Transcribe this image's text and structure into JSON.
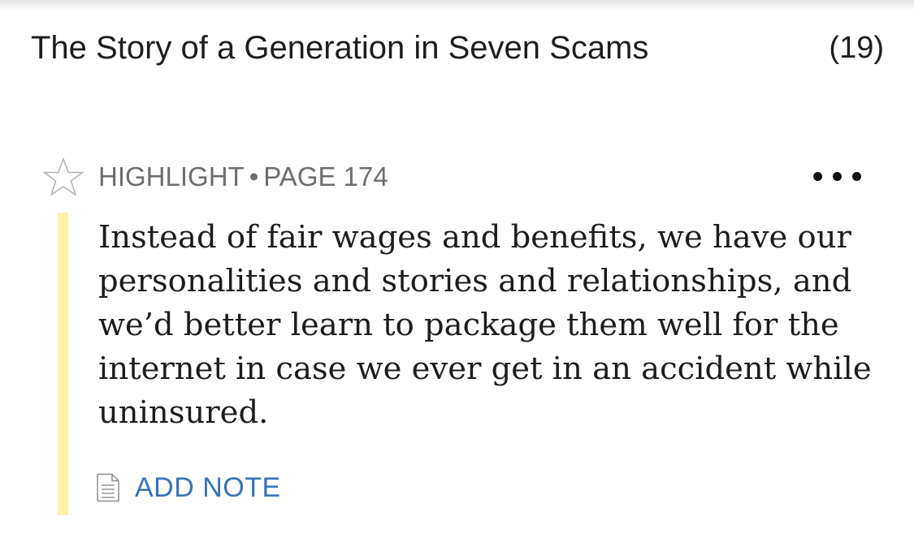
{
  "header": {
    "book_title": "The Story of a Generation in Seven Scams",
    "highlight_count": "(19)"
  },
  "annotation": {
    "type_label": "HIGHLIGHT",
    "separator": "•",
    "location_label": "PAGE 174",
    "quote_text": "Instead of fair wages and benefits, we have our personalities and stories and relationships, and we’d better learn to package them well for the internet in case we ever get in an accident while uninsured.",
    "highlight_color": "#fbf3a6",
    "star_icon": "star-outline-icon",
    "more_icon": "ellipsis-icon"
  },
  "actions": {
    "add_note_label": "ADD NOTE",
    "add_note_icon": "note-document-icon",
    "link_color": "#3972b9"
  }
}
